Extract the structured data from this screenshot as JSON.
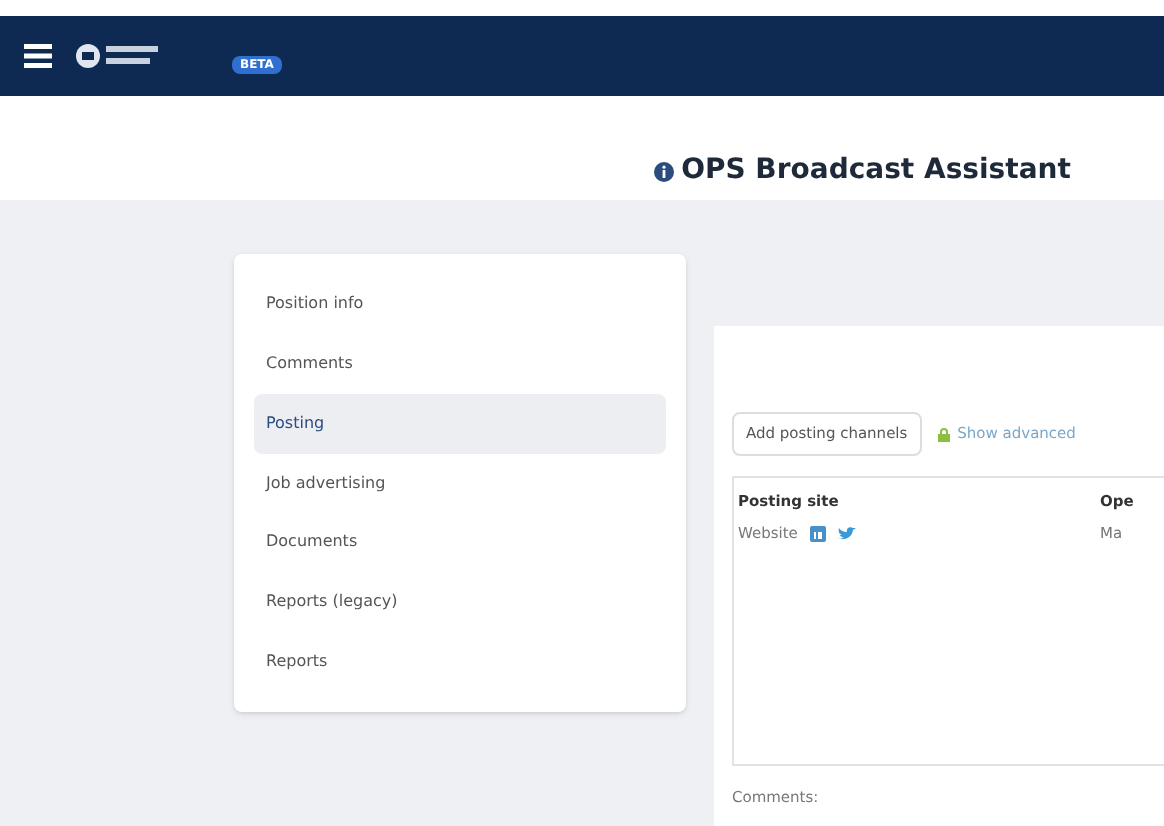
{
  "header": {
    "badge": "BETA"
  },
  "title": "OPS Broadcast Assistant",
  "sidebar": {
    "items": [
      {
        "label": "Position info",
        "selected": false
      },
      {
        "label": "Comments",
        "selected": false
      },
      {
        "label": "Posting",
        "selected": true
      },
      {
        "label": "Job advertising",
        "selected": false
      },
      {
        "label": "Documents",
        "selected": false
      },
      {
        "label": "Reports (legacy)",
        "selected": false
      },
      {
        "label": "Reports",
        "selected": false
      }
    ]
  },
  "posting": {
    "add_button": "Add posting channels",
    "advanced_link": "Show advanced",
    "table": {
      "columns": [
        "Posting site",
        "Ope"
      ],
      "rows": [
        {
          "site": "Website",
          "column_2": "Ma"
        }
      ]
    },
    "comments_label": "Comments:"
  }
}
